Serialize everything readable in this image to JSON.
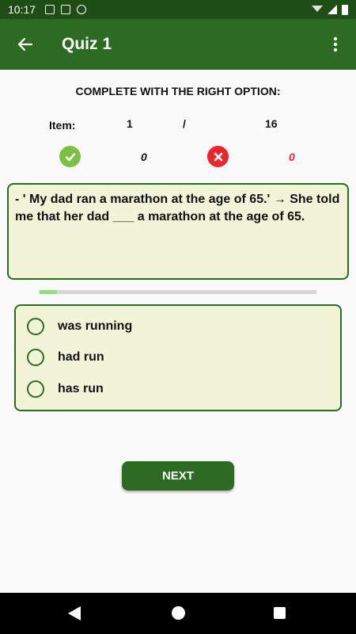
{
  "status_bar": {
    "time": "10:17",
    "left_icons": [
      "a-icon",
      "sd-card-icon",
      "no-sync-icon"
    ],
    "right_icons": [
      "wifi-icon",
      "signal-icon",
      "battery-icon"
    ]
  },
  "app_bar": {
    "title": "Quiz 1",
    "back_icon": "arrow-back-icon",
    "menu_icon": "more-vert-icon",
    "color": "#2e6b22"
  },
  "instruction": "COMPLETE WITH THE RIGHT OPTION:",
  "item": {
    "label": "Item:",
    "current": "1",
    "separator": "/",
    "total": "16"
  },
  "score": {
    "correct": "0",
    "wrong": "0",
    "correct_color": "#7cc242",
    "wrong_color": "#e8262c"
  },
  "question": {
    "text": "- ' My dad ran a marathon at the age of 65.'  → She told me that her dad ___ a marathon at the age of 65."
  },
  "progress": {
    "fraction": 0.0625
  },
  "options": [
    {
      "label": "was running",
      "selected": false
    },
    {
      "label": "had run",
      "selected": false
    },
    {
      "label": "has run",
      "selected": false
    }
  ],
  "next_button": {
    "label": "NEXT"
  },
  "nav_bar": {
    "icons": [
      "nav-back-icon",
      "nav-home-icon",
      "nav-recents-icon"
    ]
  }
}
